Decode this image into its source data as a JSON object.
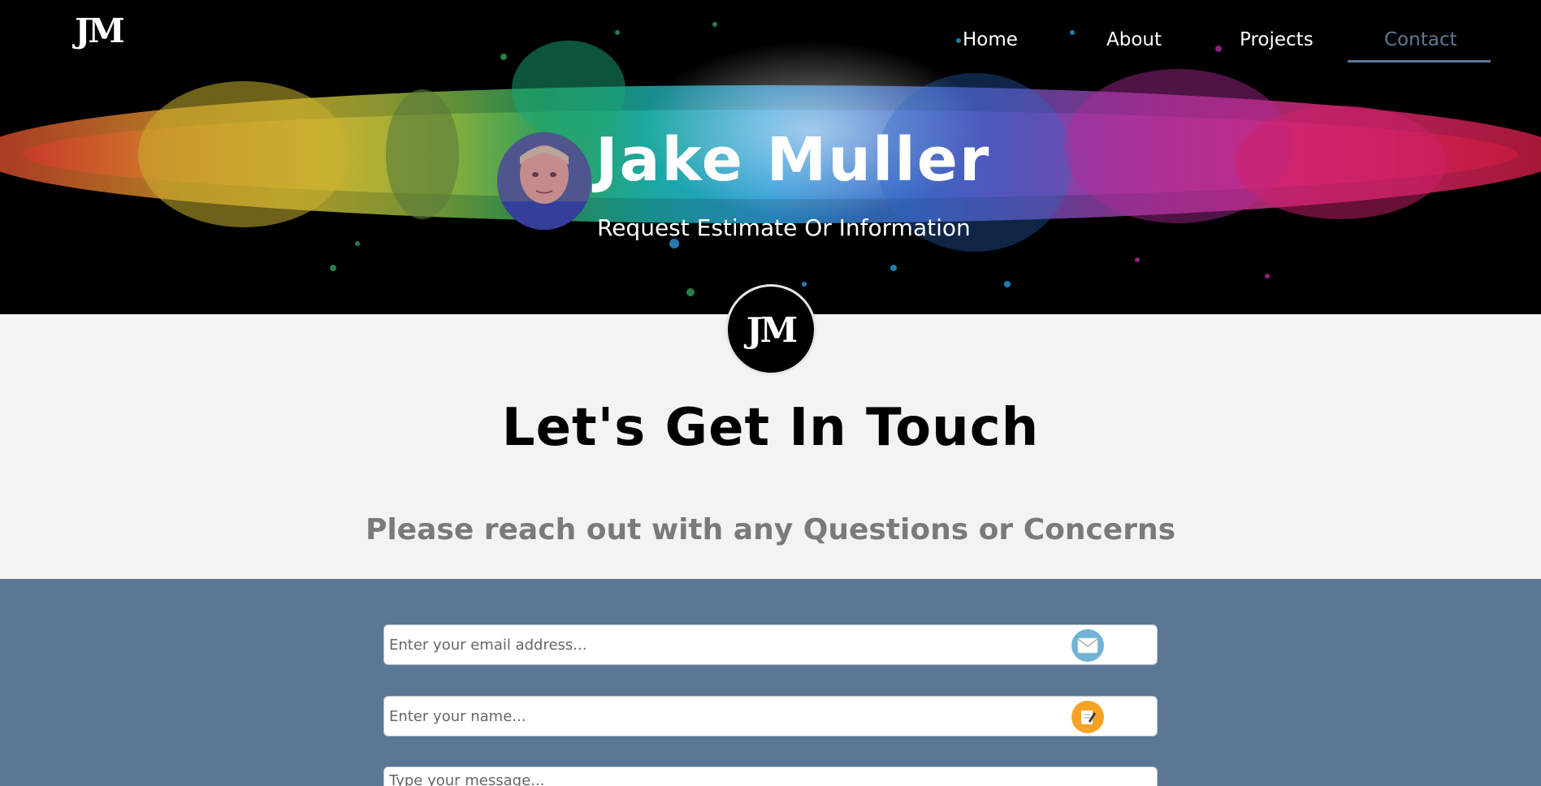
{
  "brand": {
    "logo_text": "JM"
  },
  "nav": {
    "items": [
      {
        "label": "Home"
      },
      {
        "label": "About"
      },
      {
        "label": "Projects"
      },
      {
        "label": "Contact"
      }
    ],
    "active": "Contact",
    "active_color": "#5c7896"
  },
  "hero": {
    "name": "Jake Muller",
    "subtitle": "Request Estimate Or Information"
  },
  "section": {
    "logo_text": "JM",
    "title": "Let's Get In Touch",
    "subtitle": "Please reach out with any Questions or Concerns"
  },
  "form": {
    "band_color": "#5a7795",
    "email_placeholder": "Enter your email address...",
    "name_placeholder": "Enter your name...",
    "message_placeholder": "Type your message...",
    "email_icon": "envelope-icon",
    "name_icon": "notepad-icon"
  }
}
